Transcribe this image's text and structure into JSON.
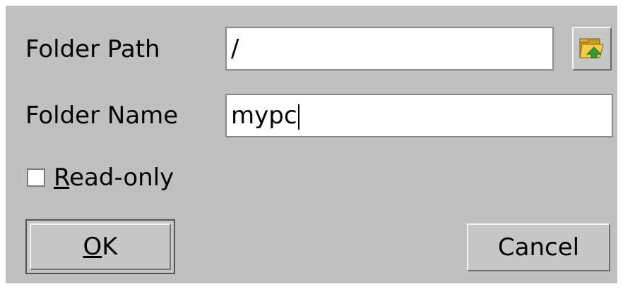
{
  "dialog": {
    "folder_path_label": "Folder Path",
    "folder_path_value": "/",
    "folder_name_label": "Folder Name",
    "folder_name_value": "mypc",
    "readonly_label_mnemonic": "R",
    "readonly_label_rest": "ead-only",
    "readonly_checked": false,
    "ok_label_mnemonic": "O",
    "ok_label_rest": "K",
    "cancel_label": "Cancel",
    "browse_icon": "folder-browse-icon"
  },
  "colors": {
    "dialog_background": "#c0c0c0",
    "field_background": "#ffffff",
    "folder_icon": "#f0c040",
    "folder_arrow": "#3a9a3a"
  }
}
